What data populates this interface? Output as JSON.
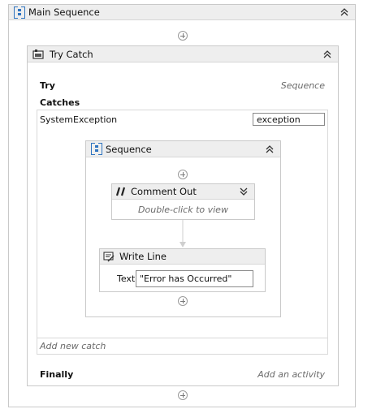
{
  "main_sequence": {
    "title": "Main Sequence",
    "icon": "sequence-icon"
  },
  "try_catch": {
    "title": "Try Catch",
    "icon": "try-catch-icon",
    "try_label": "Try",
    "try_hint": "Sequence",
    "catches_label": "Catches",
    "exception_type": "SystemException",
    "exception_var": "exception",
    "add_catch": "Add new catch",
    "finally_label": "Finally",
    "finally_hint": "Add an activity"
  },
  "inner_sequence": {
    "title": "Sequence",
    "icon": "sequence-icon"
  },
  "comment_out": {
    "title": "Comment Out",
    "hint": "Double-click to view",
    "icon": "comment-out-icon"
  },
  "write_line": {
    "title": "Write Line",
    "text_label": "Text",
    "text_value": "\"Error has Occurred\"",
    "icon": "write-line-icon"
  },
  "colors": {
    "header_bg": "#eeeeee",
    "border": "#c9c9c9",
    "accent": "#2f74c0"
  }
}
